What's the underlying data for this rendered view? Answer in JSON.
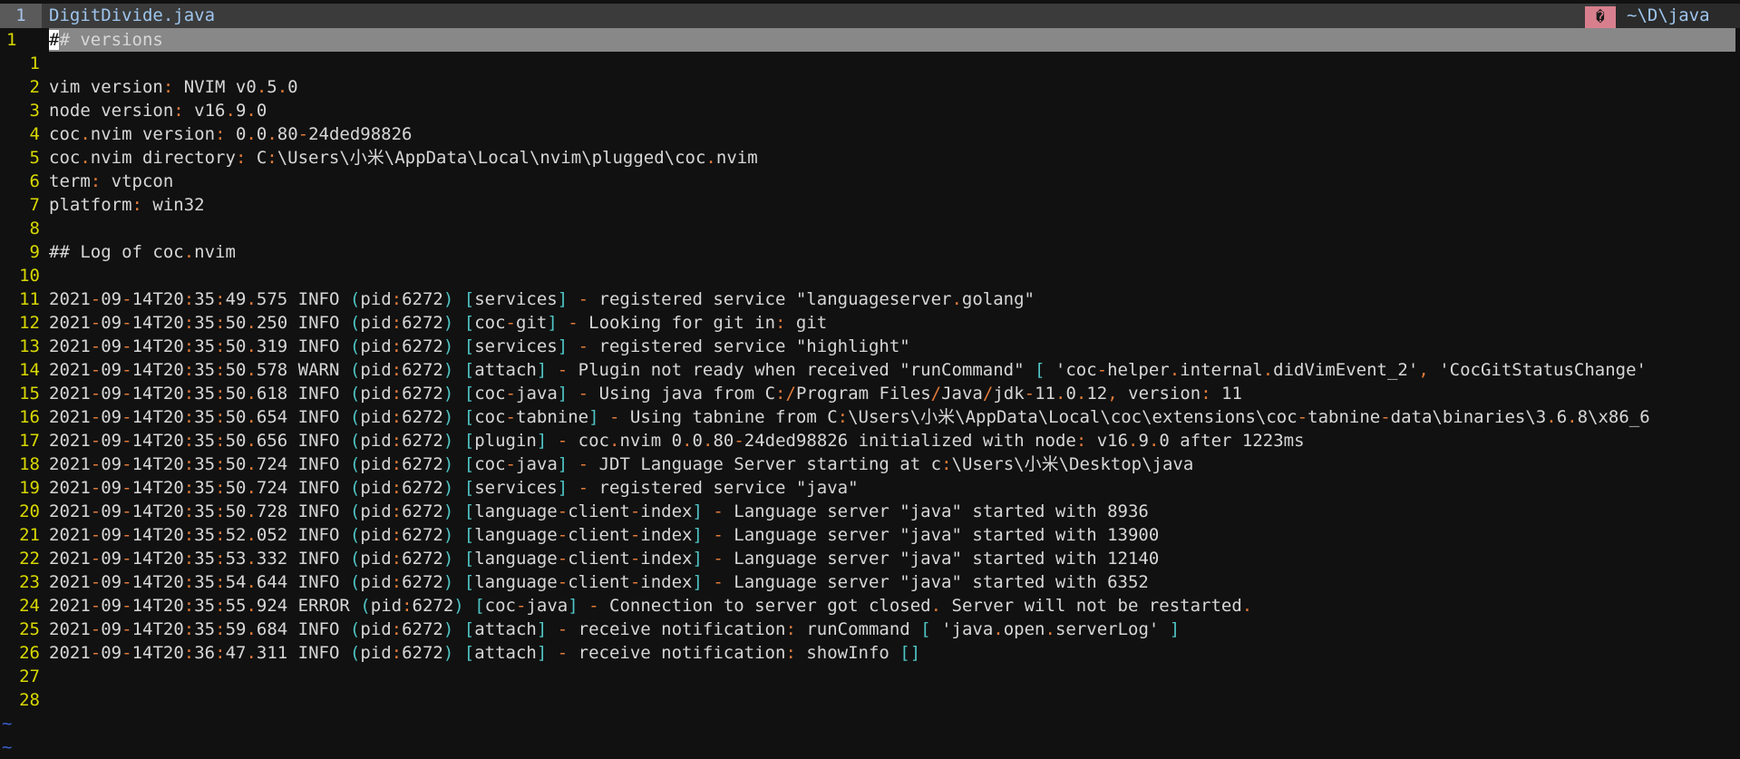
{
  "tabline": {
    "tab_number": "1",
    "filename": "DigitDivide.java",
    "badge": "�",
    "cwd": "~\\D\\java"
  },
  "lines": [
    {
      "n": "1",
      "text": "## versions",
      "current": true
    },
    {
      "n": "1",
      "text": ""
    },
    {
      "n": "2",
      "text": "vim version: NVIM v0.5.0"
    },
    {
      "n": "3",
      "text": "node version: v16.9.0"
    },
    {
      "n": "4",
      "text": "coc.nvim version: 0.0.80-24ded98826"
    },
    {
      "n": "5",
      "text": "coc.nvim directory: C:\\Users\\小米\\AppData\\Local\\nvim\\plugged\\coc.nvim"
    },
    {
      "n": "6",
      "text": "term: vtpcon"
    },
    {
      "n": "7",
      "text": "platform: win32"
    },
    {
      "n": "8",
      "text": ""
    },
    {
      "n": "9",
      "text": "## Log of coc.nvim"
    },
    {
      "n": "10",
      "text": ""
    },
    {
      "n": "11",
      "text": "2021-09-14T20:35:49.575 INFO (pid:6272) [services] - registered service \"languageserver.golang\""
    },
    {
      "n": "12",
      "text": "2021-09-14T20:35:50.250 INFO (pid:6272) [coc-git] - Looking for git in: git"
    },
    {
      "n": "13",
      "text": "2021-09-14T20:35:50.319 INFO (pid:6272) [services] - registered service \"highlight\""
    },
    {
      "n": "14",
      "text": "2021-09-14T20:35:50.578 WARN (pid:6272) [attach] - Plugin not ready when received \"runCommand\" [ 'coc-helper.internal.didVimEvent_2', 'CocGitStatusChange'"
    },
    {
      "n": "15",
      "text": "2021-09-14T20:35:50.618 INFO (pid:6272) [coc-java] - Using java from C:/Program Files/Java/jdk-11.0.12, version: 11"
    },
    {
      "n": "16",
      "text": "2021-09-14T20:35:50.654 INFO (pid:6272) [coc-tabnine] - Using tabnine from C:\\Users\\小米\\AppData\\Local\\coc\\extensions\\coc-tabnine-data\\binaries\\3.6.8\\x86_6"
    },
    {
      "n": "17",
      "text": "2021-09-14T20:35:50.656 INFO (pid:6272) [plugin] - coc.nvim 0.0.80-24ded98826 initialized with node: v16.9.0 after 1223ms"
    },
    {
      "n": "18",
      "text": "2021-09-14T20:35:50.724 INFO (pid:6272) [coc-java] - JDT Language Server starting at c:\\Users\\小米\\Desktop\\java"
    },
    {
      "n": "19",
      "text": "2021-09-14T20:35:50.724 INFO (pid:6272) [services] - registered service \"java\""
    },
    {
      "n": "20",
      "text": "2021-09-14T20:35:50.728 INFO (pid:6272) [language-client-index] - Language server \"java\" started with 8936"
    },
    {
      "n": "21",
      "text": "2021-09-14T20:35:52.052 INFO (pid:6272) [language-client-index] - Language server \"java\" started with 13900"
    },
    {
      "n": "22",
      "text": "2021-09-14T20:35:53.332 INFO (pid:6272) [language-client-index] - Language server \"java\" started with 12140"
    },
    {
      "n": "23",
      "text": "2021-09-14T20:35:54.644 INFO (pid:6272) [language-client-index] - Language server \"java\" started with 6352"
    },
    {
      "n": "24",
      "text": "2021-09-14T20:35:55.924 ERROR (pid:6272) [coc-java] - Connection to server got closed. Server will not be restarted."
    },
    {
      "n": "25",
      "text": "2021-09-14T20:35:59.684 INFO (pid:6272) [attach] - receive notification: runCommand [ 'java.open.serverLog' ]"
    },
    {
      "n": "26",
      "text": "2021-09-14T20:36:47.311 INFO (pid:6272) [attach] - receive notification: showInfo []"
    },
    {
      "n": "27",
      "text": ""
    },
    {
      "n": "28",
      "text": ""
    }
  ],
  "filler": [
    "~",
    "~"
  ],
  "colors": {
    "background": "#111111",
    "line_number": "#d8d800",
    "punctuation": "#e07a3a",
    "bracket": "#4fc4c4",
    "tilde": "#3a5fd0",
    "badge": "#d87f8e"
  }
}
